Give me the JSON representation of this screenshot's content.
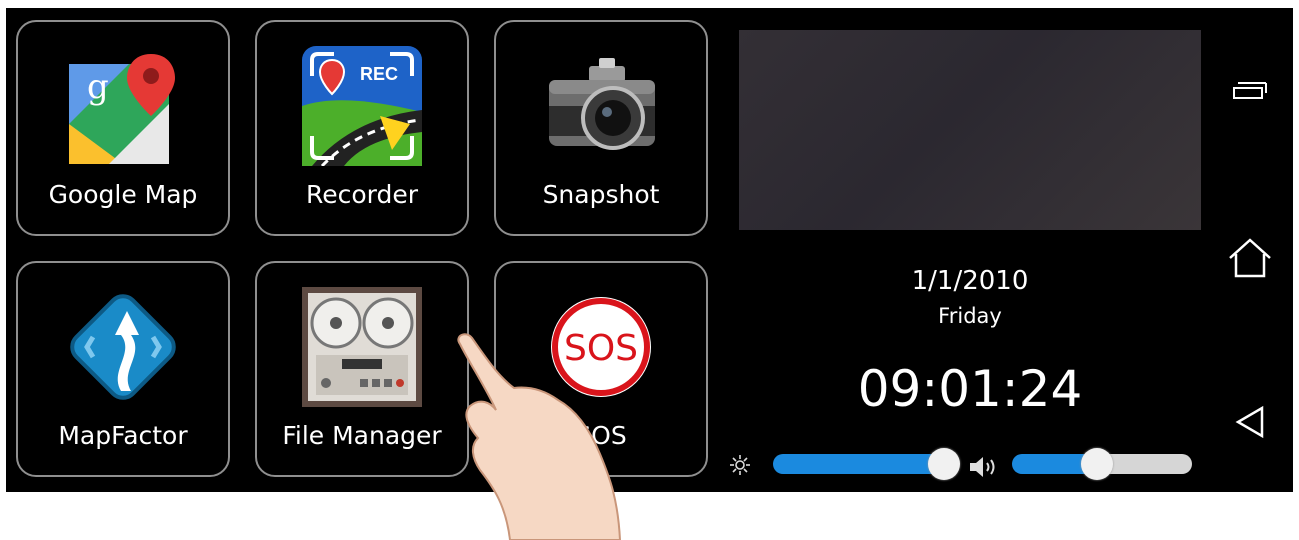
{
  "apps": [
    {
      "label": "Google Map",
      "icon": "google-maps-icon"
    },
    {
      "label": "Recorder",
      "icon": "recorder-icon",
      "badge": "REC"
    },
    {
      "label": "Snapshot",
      "icon": "camera-icon"
    },
    {
      "label": "MapFactor",
      "icon": "mapfactor-icon"
    },
    {
      "label": "File Manager",
      "icon": "tape-recorder-icon"
    },
    {
      "label": "SOS",
      "icon": "sos-icon",
      "badge": "SOS"
    }
  ],
  "clock": {
    "date": "1/1/2010",
    "weekday": "Friday",
    "time": "09:01:24"
  },
  "brightness": {
    "icon": "brightness-icon",
    "level": 0.93
  },
  "volume": {
    "icon": "speaker-icon",
    "level": 0.47
  },
  "nav": {
    "recents_icon": "recents-icon",
    "home_icon": "home-icon",
    "back_icon": "back-icon"
  },
  "colors": {
    "accent": "#1b8adf",
    "track": "#d6d6d6",
    "background": "#000000",
    "tile_border": "#8f8f8f"
  }
}
